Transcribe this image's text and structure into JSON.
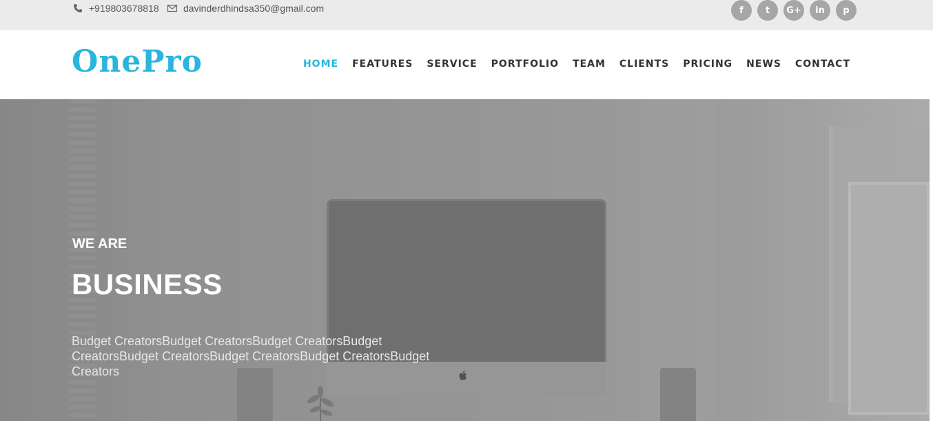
{
  "topbar": {
    "phone": "+919803678818",
    "email": "davinderdhindsa350@gmail.com",
    "socials": [
      {
        "icon": "facebook-icon",
        "glyph": "f"
      },
      {
        "icon": "twitter-icon",
        "glyph": "t"
      },
      {
        "icon": "google-plus-icon",
        "glyph": "G+"
      },
      {
        "icon": "linkedin-icon",
        "glyph": "in"
      },
      {
        "icon": "pinterest-icon",
        "glyph": "p"
      }
    ]
  },
  "header": {
    "logo": "OnePro",
    "nav": [
      "HOME",
      "FEATURES",
      "SERVICE",
      "PORTFOLIO",
      "TEAM",
      "CLIENTS",
      "PRICING",
      "NEWS",
      "CONTACT"
    ],
    "active": "HOME"
  },
  "hero": {
    "kicker": "WE ARE",
    "title": "BUSINESS",
    "text": "Budget CreatorsBudget CreatorsBudget CreatorsBudget CreatorsBudget CreatorsBudget CreatorsBudget CreatorsBudget Creators"
  },
  "colors": {
    "accent": "#29b5dd",
    "topbar_bg": "#ebebeb",
    "social_bg": "#a6a6a6"
  }
}
